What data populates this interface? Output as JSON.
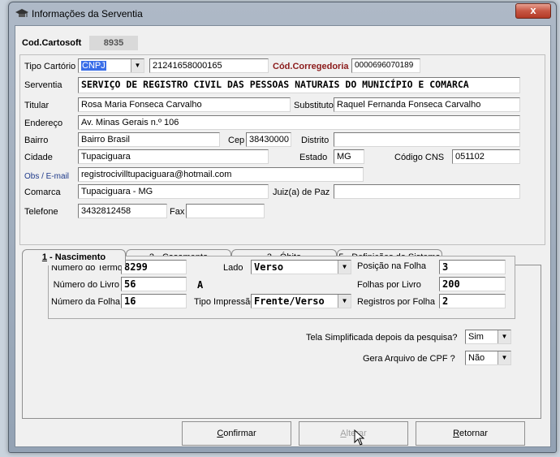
{
  "window": {
    "title": "Informações da Serventia",
    "close_label": "x"
  },
  "cod_cartosoft": {
    "label": "Cod.Cartosoft",
    "value": "8935"
  },
  "form": {
    "tipo_cartorio_label": "Tipo Cartório",
    "tipo_cartorio_value": "CNPJ",
    "cnpj_value": "21241658000165",
    "cod_corregedoria_label": "Cód.Corregedoria",
    "cod_corregedoria_value": "0000696070189",
    "serventia_label": "Serventia",
    "serventia_value": "SERVIÇO DE REGISTRO CIVIL DAS PESSOAS NATURAIS DO MUNICÍPIO E COMARCA",
    "titular_label": "Titular",
    "titular_value": "Rosa Maria Fonseca Carvalho",
    "substituto_label": "Substituto",
    "substituto_value": "Raquel Fernanda Fonseca Carvalho",
    "endereco_label": "Endereço",
    "endereco_value": "Av. Minas Gerais n.º 106",
    "bairro_label": "Bairro",
    "bairro_value": "Bairro Brasil",
    "cep_label": "Cep",
    "cep_value": "38430000",
    "distrito_label": "Distrito",
    "distrito_value": "",
    "cidade_label": "Cidade",
    "cidade_value": "Tupaciguara",
    "estado_label": "Estado",
    "estado_value": "MG",
    "codigo_cns_label": "Código CNS",
    "codigo_cns_value": "051102",
    "obs_label": "Obs / E-mail",
    "obs_value": "registrocivilltupaciguara@hotmail.com",
    "comarca_label": "Comarca",
    "comarca_value": "Tupaciguara - MG",
    "juiz_label": "Juiz(a) de Paz",
    "juiz_value": "",
    "telefone_label": "Telefone",
    "telefone_value": "3432812458",
    "fax_label": "Fax",
    "fax_value": ""
  },
  "tabs": [
    {
      "num": "1",
      "label": " - Nascimento"
    },
    {
      "num": "2",
      "label": " - Casamento"
    },
    {
      "num": "3",
      "label": " - Óbito"
    },
    {
      "num": "",
      "label": "5 - Definições do Sistema"
    }
  ],
  "nascimento": {
    "numero_termo_label": "Número do Termo",
    "numero_termo_value": "8299",
    "numero_livro_label": "Número do Livro",
    "numero_livro_value": "56",
    "livro_suffix": "A",
    "numero_folha_label": "Número da Folha",
    "numero_folha_value": "16",
    "lado_label": "Lado",
    "lado_value": "Verso",
    "tipo_impressao_label": "Tipo Impressão",
    "tipo_impressao_value": "Frente/Verso",
    "posicao_folha_label": "Posição na Folha",
    "posicao_folha_value": "3",
    "folhas_livro_label": "Folhas por Livro",
    "folhas_livro_value": "200",
    "registros_folha_label": "Registros por Folha",
    "registros_folha_value": "2"
  },
  "options": {
    "tela_simplificada_label": "Tela Simplificada depois da pesquisa?",
    "tela_simplificada_value": "Sim",
    "gera_cpf_label": "Gera Arquivo de CPF ?",
    "gera_cpf_value": "Não"
  },
  "buttons": {
    "confirmar_u": "C",
    "confirmar_rest": "onfirmar",
    "alterar_u": "A",
    "alterar_rest": "lterar",
    "retornar_u": "R",
    "retornar_rest": "etornar"
  },
  "colors": {
    "accent_red": "#8b1a1a",
    "accent_blue": "#1f3a8a",
    "selection": "#3a6ee8"
  }
}
